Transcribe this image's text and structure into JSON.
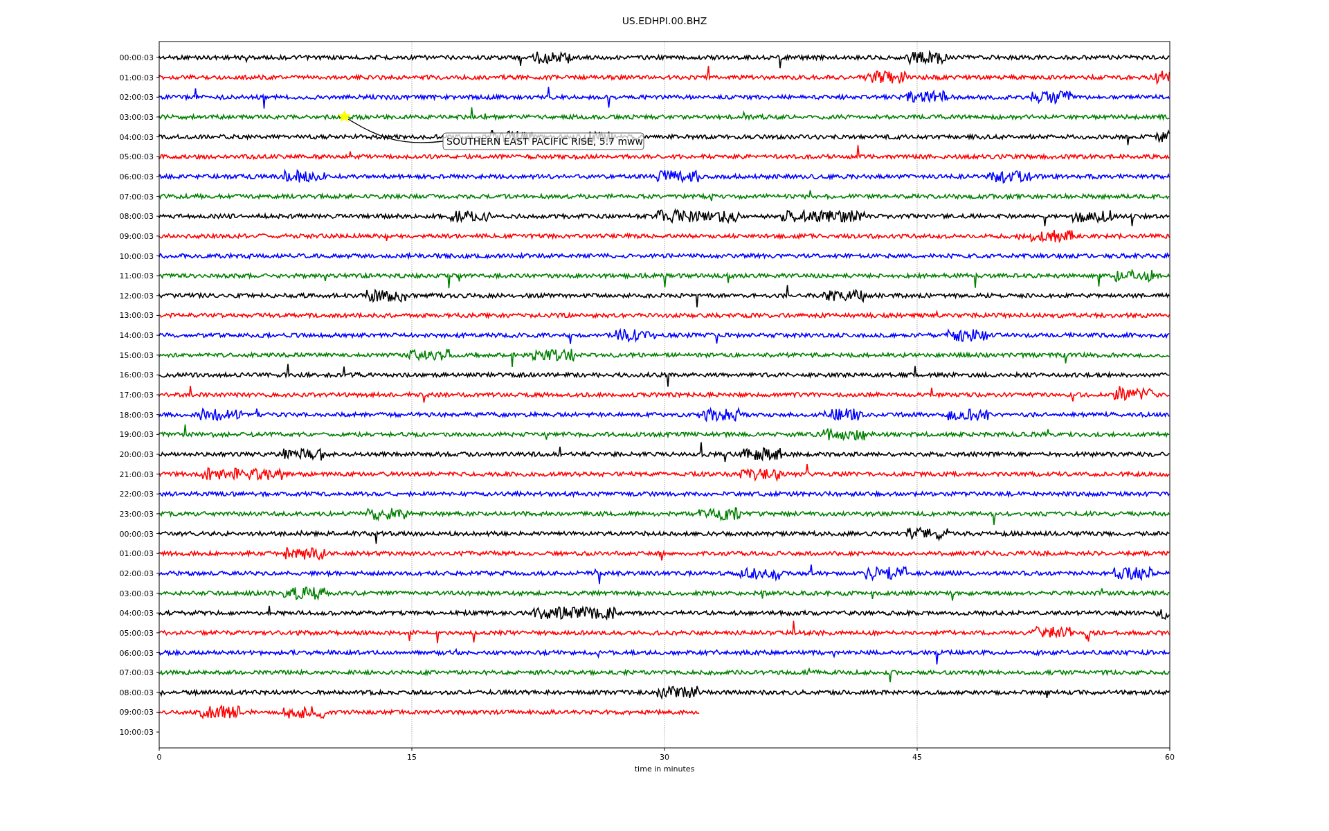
{
  "title": "US.EDHPI.00.BHZ",
  "rows": [
    {
      "label": "00:00:03",
      "trace": {
        "color": "#000000",
        "level": 1
      }
    },
    {
      "label": "01:00:03",
      "trace": {
        "color": "#ff0000",
        "level": 1
      }
    },
    {
      "label": "02:00:03",
      "trace": {
        "color": "#0000ff",
        "level": 1
      }
    },
    {
      "label": "03:00:03",
      "trace": {
        "color": "#008000",
        "level": 1
      }
    },
    {
      "label": "04:00:03",
      "trace": {
        "color": "#000000",
        "level": 1
      }
    },
    {
      "label": "05:00:03",
      "trace": {
        "color": "#ff0000",
        "level": 1
      }
    },
    {
      "label": "06:00:03",
      "trace": {
        "color": "#0000ff",
        "level": 1
      }
    },
    {
      "label": "07:00:03",
      "trace": {
        "color": "#008000",
        "level": 1
      }
    },
    {
      "label": "08:00:03",
      "trace": {
        "color": "#000000",
        "level": 1
      }
    },
    {
      "label": "09:00:03",
      "trace": {
        "color": "#ff0000",
        "level": 1
      }
    },
    {
      "label": "10:00:03",
      "trace": {
        "color": "#0000ff",
        "level": 1
      }
    },
    {
      "label": "11:00:03",
      "trace": {
        "color": "#008000",
        "level": 1
      }
    },
    {
      "label": "12:00:03",
      "trace": {
        "color": "#000000",
        "level": 1
      }
    },
    {
      "label": "13:00:03",
      "trace": {
        "color": "#ff0000",
        "level": 1
      }
    },
    {
      "label": "14:00:03",
      "trace": {
        "color": "#0000ff",
        "level": 1
      }
    },
    {
      "label": "15:00:03",
      "trace": {
        "color": "#008000",
        "level": 1
      }
    },
    {
      "label": "16:00:03",
      "trace": {
        "color": "#000000",
        "level": 1
      }
    },
    {
      "label": "17:00:03",
      "trace": {
        "color": "#ff0000",
        "level": 1
      }
    },
    {
      "label": "18:00:03",
      "trace": {
        "color": "#0000ff",
        "level": 1
      }
    },
    {
      "label": "19:00:03",
      "trace": {
        "color": "#008000",
        "level": 1
      }
    },
    {
      "label": "20:00:03",
      "trace": {
        "color": "#000000",
        "level": 1
      }
    },
    {
      "label": "21:00:03",
      "trace": {
        "color": "#ff0000",
        "level": 1
      }
    },
    {
      "label": "22:00:03",
      "trace": {
        "color": "#0000ff",
        "level": 1
      }
    },
    {
      "label": "23:00:03",
      "trace": {
        "color": "#008000",
        "level": 1
      }
    },
    {
      "label": "00:00:03",
      "trace": {
        "color": "#000000",
        "level": 1
      }
    },
    {
      "label": "01:00:03",
      "trace": {
        "color": "#ff0000",
        "level": 1
      }
    },
    {
      "label": "02:00:03",
      "trace": {
        "color": "#0000ff",
        "level": 1
      }
    },
    {
      "label": "03:00:03",
      "trace": {
        "color": "#008000",
        "level": 1
      }
    },
    {
      "label": "04:00:03",
      "trace": {
        "color": "#000000",
        "level": 1
      }
    },
    {
      "label": "05:00:03",
      "trace": {
        "color": "#ff0000",
        "level": 1
      }
    },
    {
      "label": "06:00:03",
      "trace": {
        "color": "#0000ff",
        "level": 1
      }
    },
    {
      "label": "07:00:03",
      "trace": {
        "color": "#008000",
        "level": 1
      }
    },
    {
      "label": "08:00:03",
      "trace": {
        "color": "#000000",
        "level": 1
      }
    },
    {
      "label": "09:00:03",
      "trace": {
        "color": "#ff0000",
        "level": 0.535
      }
    },
    {
      "label": "10:00:03"
    }
  ],
  "xticks": [
    "0",
    "15",
    "30",
    "45",
    "60"
  ],
  "xlabel": "time in minutes",
  "annotation": {
    "text": "SOUTHERN EAST PACIFIC RISE, 5.7 mww"
  }
}
